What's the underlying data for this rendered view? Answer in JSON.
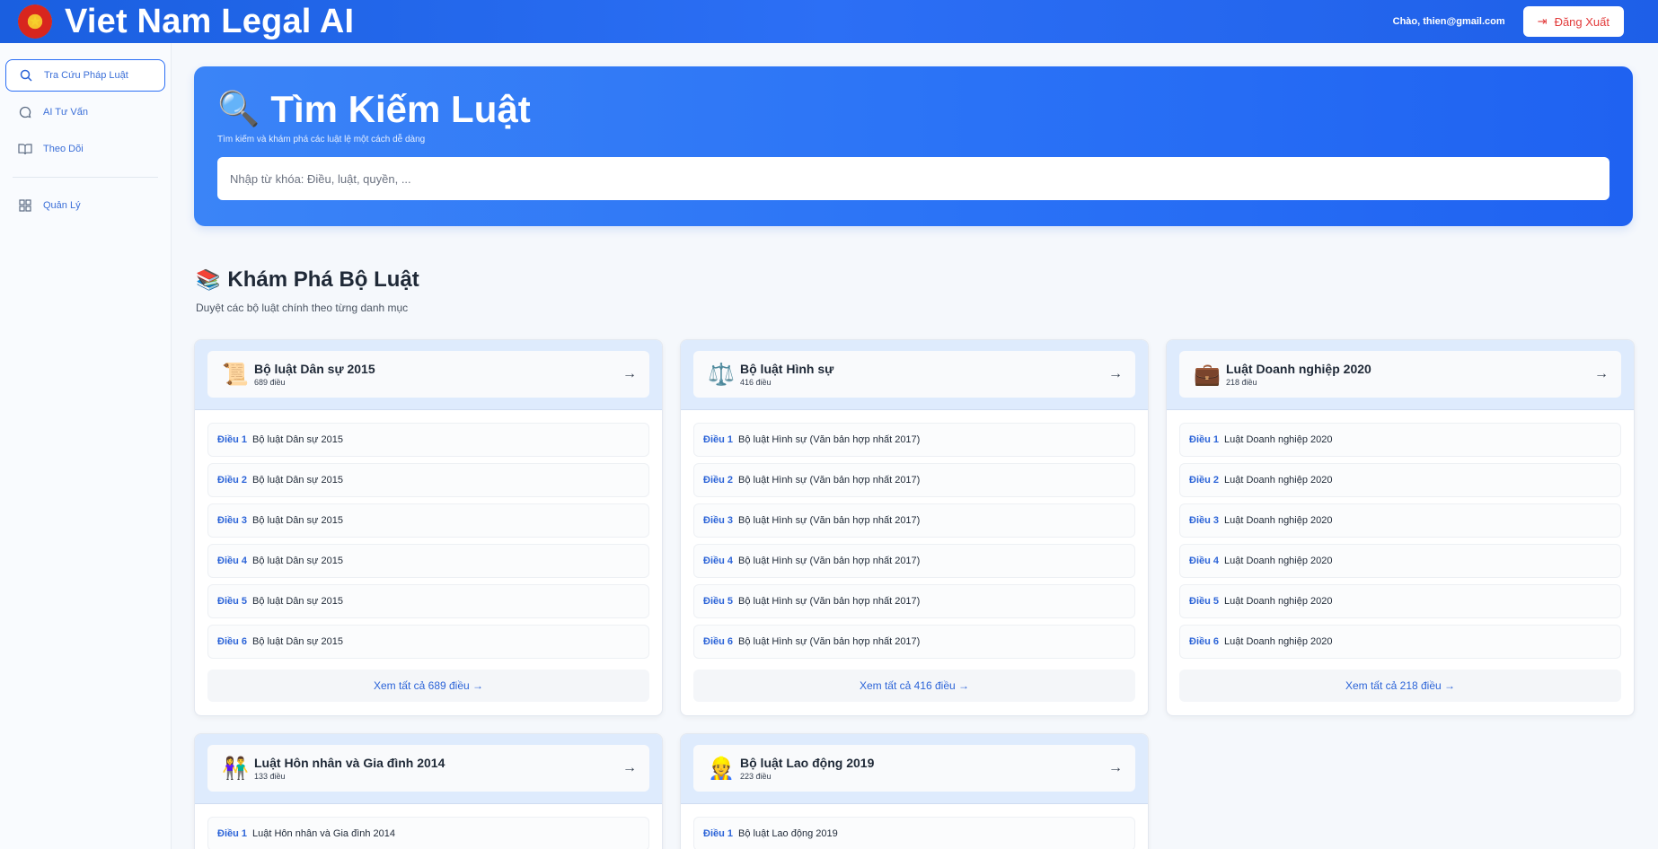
{
  "header": {
    "app_title": "Viet Nam Legal AI",
    "emblem_icon": "star-emblem",
    "greeting": "Chào, thien@gmail.com",
    "logout_label": "Đăng Xuất"
  },
  "sidebar": {
    "items": [
      {
        "label": "Tra Cứu Pháp Luật",
        "icon": "search-icon",
        "active": true
      },
      {
        "label": "AI Tư Vấn",
        "icon": "chat-icon"
      },
      {
        "label": "Theo Dõi",
        "icon": "book-icon"
      },
      {
        "label": "Quản Lý",
        "icon": "grid-icon"
      }
    ]
  },
  "hero": {
    "title": "Tìm Kiếm Luật",
    "subtitle": "Tìm kiếm và khám phá các luật lệ một cách dễ dàng",
    "search_placeholder": "Nhập từ khóa: Điều, luật, quyền, ..."
  },
  "section": {
    "title": "Khám Phá Bộ Luật",
    "subtitle": "Duyệt các bộ luật chính theo từng danh mục"
  },
  "cards": [
    {
      "icon": "📜",
      "title": "Bộ luật Dân sự 2015",
      "count": "689 điều",
      "articles": [
        {
          "num": "Điều 1",
          "text": "Bộ luật Dân sự 2015"
        },
        {
          "num": "Điều 2",
          "text": "Bộ luật Dân sự 2015"
        },
        {
          "num": "Điều 3",
          "text": "Bộ luật Dân sự 2015"
        },
        {
          "num": "Điều 4",
          "text": "Bộ luật Dân sự 2015"
        },
        {
          "num": "Điều 5",
          "text": "Bộ luật Dân sự 2015"
        },
        {
          "num": "Điều 6",
          "text": "Bộ luật Dân sự 2015"
        }
      ],
      "view_all": "Xem tất cả 689 điều →"
    },
    {
      "icon": "⚖️",
      "title": "Bộ luật Hình sự",
      "count": "416 điều",
      "articles": [
        {
          "num": "Điều 1",
          "text": "Bộ luật Hình sự (Văn bản hợp nhất 2017)"
        },
        {
          "num": "Điều 2",
          "text": "Bộ luật Hình sự (Văn bản hợp nhất 2017)"
        },
        {
          "num": "Điều 3",
          "text": "Bộ luật Hình sự (Văn bản hợp nhất 2017)"
        },
        {
          "num": "Điều 4",
          "text": "Bộ luật Hình sự (Văn bản hợp nhất 2017)"
        },
        {
          "num": "Điều 5",
          "text": "Bộ luật Hình sự (Văn bản hợp nhất 2017)"
        },
        {
          "num": "Điều 6",
          "text": "Bộ luật Hình sự (Văn bản hợp nhất 2017)"
        }
      ],
      "view_all": "Xem tất cả 416 điều →"
    },
    {
      "icon": "💼",
      "title": "Luật Doanh nghiệp 2020",
      "count": "218 điều",
      "articles": [
        {
          "num": "Điều 1",
          "text": "Luật Doanh nghiệp 2020"
        },
        {
          "num": "Điều 2",
          "text": "Luật Doanh nghiệp 2020"
        },
        {
          "num": "Điều 3",
          "text": "Luật Doanh nghiệp 2020"
        },
        {
          "num": "Điều 4",
          "text": "Luật Doanh nghiệp 2020"
        },
        {
          "num": "Điều 5",
          "text": "Luật Doanh nghiệp 2020"
        },
        {
          "num": "Điều 6",
          "text": "Luật Doanh nghiệp 2020"
        }
      ],
      "view_all": "Xem tất cả 218 điều →"
    },
    {
      "icon": "👫",
      "title": "Luật Hôn nhân và Gia đình 2014",
      "count": "133 điều",
      "articles": [
        {
          "num": "Điều 1",
          "text": "Luật Hôn nhân và Gia đình 2014"
        }
      ]
    },
    {
      "icon": "👷",
      "title": "Bộ luật Lao động 2019",
      "count": "223 điều",
      "articles": [
        {
          "num": "Điều 1",
          "text": "Bộ luật Lao động 2019"
        }
      ]
    }
  ]
}
